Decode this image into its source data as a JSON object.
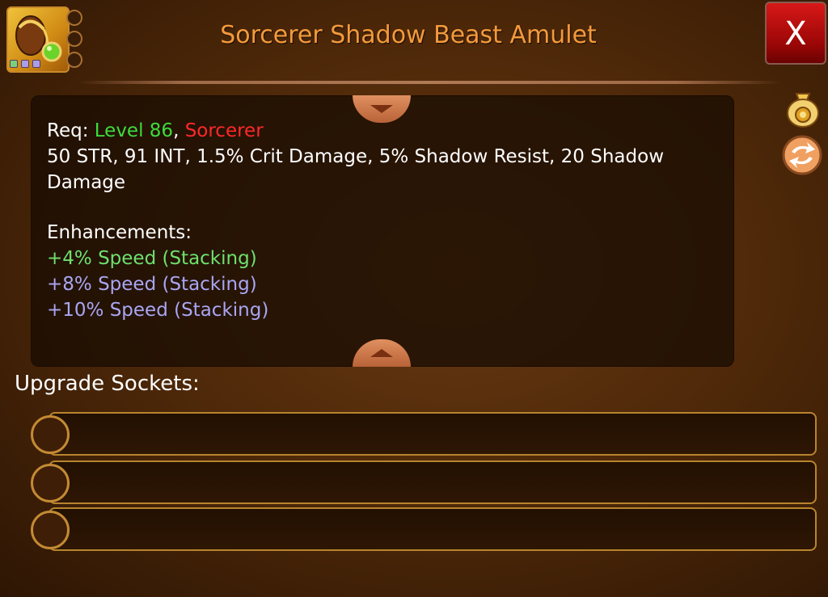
{
  "header": {
    "title": "Sorcerer Shadow Beast Amulet",
    "close_label": "X"
  },
  "item_icon": {
    "name": "amulet-icon",
    "gem_colors": [
      "#7ad07a",
      "#a99ee8",
      "#a99ee8"
    ]
  },
  "description": {
    "req_label": "Req: ",
    "level": "Level 86",
    "req_separator": ", ",
    "class": "Sorcerer",
    "stats": "50 STR, 91 INT, 1.5% Crit Damage, 5% Shadow Resist, 20 Shadow Damage",
    "enhancements_label": "Enhancements:",
    "enhancements": [
      {
        "text": "+4% Speed (Stacking)",
        "color": "#6ee06e"
      },
      {
        "text": "+8% Speed (Stacking)",
        "color": "#a9a6f2"
      },
      {
        "text": "+10% Speed (Stacking)",
        "color": "#a9a6f2"
      }
    ]
  },
  "side_buttons": {
    "sell_icon": "gold-bag-icon",
    "swap_icon": "swap-arrows-icon"
  },
  "sockets": {
    "label": "Upgrade Sockets:",
    "rows": [
      {
        "name": "socket-1"
      },
      {
        "name": "socket-2"
      },
      {
        "name": "socket-3"
      }
    ]
  },
  "colors": {
    "title": "#f39a3c",
    "level": "#3ddc3d",
    "class": "#ff2828",
    "close": "#c40c0c"
  }
}
